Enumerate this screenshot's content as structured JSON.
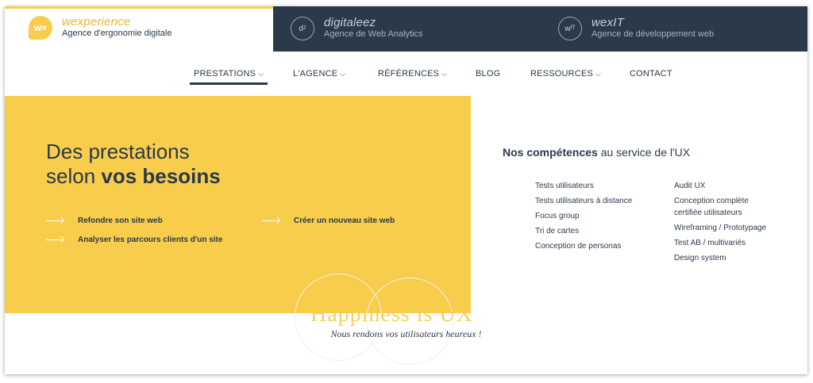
{
  "brands": [
    {
      "logo": "w×",
      "name": "wexperience",
      "tagline": "Agence d'ergonomie digitale"
    },
    {
      "logo": "dᶻ",
      "name": "digitaleez",
      "tagline": "Agence de Web Analytics"
    },
    {
      "logo": "wᴵᵀ",
      "name": "wexIT",
      "tagline": "Agence de développement web"
    }
  ],
  "nav": {
    "items": [
      {
        "label": "PRESTATIONS",
        "chevron": "⌵"
      },
      {
        "label": "L'AGENCE",
        "chevron": "⌵"
      },
      {
        "label": "RÉFÉRENCES",
        "chevron": "⌵"
      },
      {
        "label": "BLOG"
      },
      {
        "label": "RESSOURCES",
        "chevron": "⌵"
      },
      {
        "label": "CONTACT"
      }
    ]
  },
  "hero": {
    "line1": "Des prestations",
    "line2_pre": "selon ",
    "line2_bold": "vos besoins",
    "links": [
      "Refondre son site web",
      "Analyser les parcours clients d'un site",
      "Créer un nouveau site web"
    ]
  },
  "competences": {
    "title_bold": "Nos compétences",
    "title_rest": " au service de l'UX",
    "col1": [
      "Tests utilisateurs",
      "Tests utilisateurs à distance",
      "Focus group",
      "Tri de cartes",
      "Conception de personas"
    ],
    "col2": [
      "Audit UX",
      "Conception complète certifiée utilisateurs",
      "Wireframing / Prototypage",
      "Test AB / multivariés",
      "Design system"
    ]
  },
  "footer": {
    "happiness": "Happiness is UX",
    "tagline": "Nous rendons vos utilisateurs heureux !"
  },
  "colors": {
    "accent": "#f7cd4b",
    "dark": "#2b3a4a"
  }
}
